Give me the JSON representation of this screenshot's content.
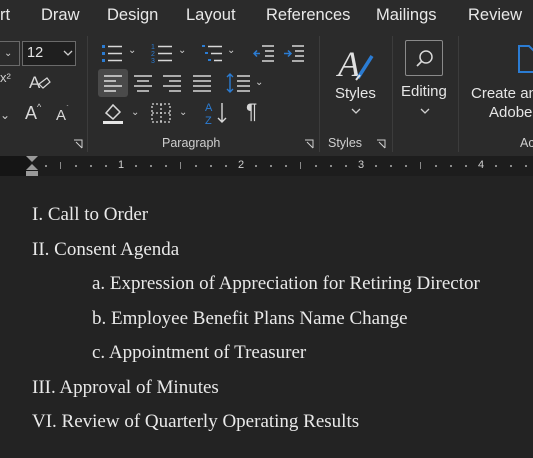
{
  "menu": [
    "rt",
    "Draw",
    "Design",
    "Layout",
    "References",
    "Mailings",
    "Review"
  ],
  "font": {
    "size": "12"
  },
  "groups": {
    "paragraph": "Paragraph",
    "styles": "Styles"
  },
  "buttons": {
    "styles": "Styles",
    "editing": "Editing",
    "create_line1": "Create an",
    "create_line2": "Adobe",
    "partial_group": "Ac"
  },
  "ruler": {
    "numbers": [
      "1",
      "2",
      "3",
      "4"
    ]
  },
  "document": {
    "lines": [
      "I. Call to Order",
      "II. Consent Agenda",
      "a. Expression of Appreciation for Retiring Director",
      "b. Employee Benefit Plans Name Change",
      "c. Appointment of Treasurer",
      "III. Approval of Minutes",
      "VI. Review of Quarterly Operating Results"
    ]
  },
  "colors": {
    "accent": "#2b7cd3",
    "ribbon_bg": "#2b2b2b",
    "doc_bg": "#232323"
  }
}
